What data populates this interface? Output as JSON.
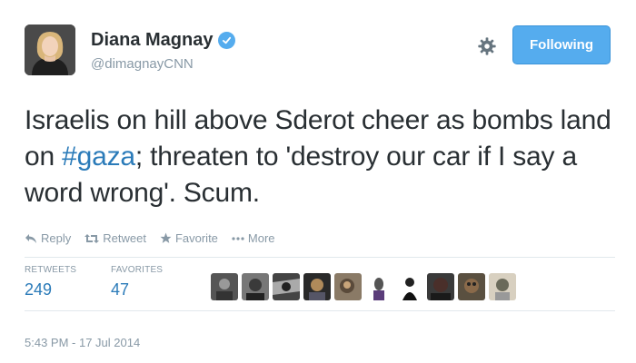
{
  "tweet": {
    "fullname": "Diana Magnay",
    "screenname": "@dimagnayCNN",
    "verified_icon": "verified-badge-icon",
    "follow_button": "Following",
    "text_part1": "Israelis on hill above Sderot cheer as bombs land on ",
    "hashtag": "#gaza",
    "text_part2": "; threaten to 'destroy our car if I say a word wrong'. Scum.",
    "timestamp": "5:43 PM - 17 Jul 2014"
  },
  "actions": {
    "reply": "Reply",
    "retweet": "Retweet",
    "favorite": "Favorite",
    "more": "More"
  },
  "stats": {
    "retweets_label": "RETWEETS",
    "retweets_value": "249",
    "favorites_label": "FAVORITES",
    "favorites_value": "47"
  },
  "colors": {
    "accent": "#55acee",
    "link": "#2b7bb9",
    "muted": "#8899a6"
  }
}
